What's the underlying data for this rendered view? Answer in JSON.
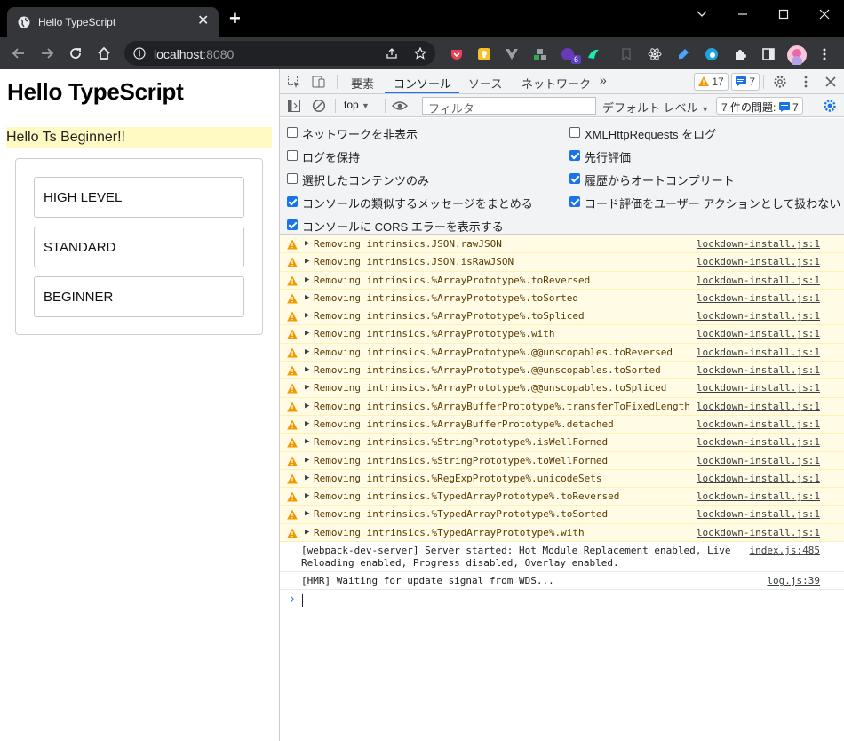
{
  "browser": {
    "tab_title": "Hello TypeScript",
    "url_host": "localhost",
    "url_port": ":8080",
    "extension_badge": "6"
  },
  "page": {
    "heading": "Hello TypeScript",
    "greeting": "Hello Ts Beginner!!",
    "buttons": [
      "HIGH LEVEL",
      "STANDARD",
      "BEGINNER"
    ]
  },
  "devtools": {
    "tabs": [
      "要素",
      "コンソール",
      "ソース",
      "ネットワーク"
    ],
    "active_tab": "コンソール",
    "warning_count": "17",
    "message_count": "7",
    "context": "top",
    "filter_placeholder": "フィルタ",
    "levels": "デフォルト レベル",
    "issues_label": "7 件の問題:",
    "issues_count": "7",
    "settings": [
      {
        "label": "ネットワークを非表示",
        "checked": false
      },
      {
        "label": "XMLHttpRequests をログ",
        "checked": false
      },
      {
        "label": "ログを保持",
        "checked": false
      },
      {
        "label": "先行評価",
        "checked": true
      },
      {
        "label": "選択したコンテンツのみ",
        "checked": false
      },
      {
        "label": "履歴からオートコンプリート",
        "checked": true
      },
      {
        "label": "コンソールの類似するメッセージをまとめる",
        "checked": true
      },
      {
        "label": "コード評価をユーザー アクションとして扱わない",
        "checked": true
      },
      {
        "label": "コンソールに CORS エラーを表示する",
        "checked": true
      }
    ],
    "warnings": [
      "Removing intrinsics.JSON.rawJSON",
      "Removing intrinsics.JSON.isRawJSON",
      "Removing intrinsics.%ArrayPrototype%.toReversed",
      "Removing intrinsics.%ArrayPrototype%.toSorted",
      "Removing intrinsics.%ArrayPrototype%.toSpliced",
      "Removing intrinsics.%ArrayPrototype%.with",
      "Removing intrinsics.%ArrayPrototype%.@@unscopables.toReversed",
      "Removing intrinsics.%ArrayPrototype%.@@unscopables.toSorted",
      "Removing intrinsics.%ArrayPrototype%.@@unscopables.toSpliced",
      "Removing intrinsics.%ArrayBufferPrototype%.transferToFixedLength",
      "Removing intrinsics.%ArrayBufferPrototype%.detached",
      "Removing intrinsics.%StringPrototype%.isWellFormed",
      "Removing intrinsics.%StringPrototype%.toWellFormed",
      "Removing intrinsics.%RegExpPrototype%.unicodeSets",
      "Removing intrinsics.%TypedArrayPrototype%.toReversed",
      "Removing intrinsics.%TypedArrayPrototype%.toSorted",
      "Removing intrinsics.%TypedArrayPrototype%.with"
    ],
    "warning_source": "lockdown-install.js:1",
    "info_messages": [
      {
        "text": "[webpack-dev-server] Server started: Hot Module Replacement enabled, Live\nReloading enabled, Progress disabled, Overlay enabled.",
        "source": "index.js:485"
      },
      {
        "text": "[HMR] Waiting for update signal from WDS...",
        "source": "log.js:39"
      }
    ]
  },
  "colors": {
    "accent": "#1a73e8",
    "warning_bg": "#fffbe5",
    "highlight": "#fff9c4",
    "warning_icon": "#f29900"
  }
}
